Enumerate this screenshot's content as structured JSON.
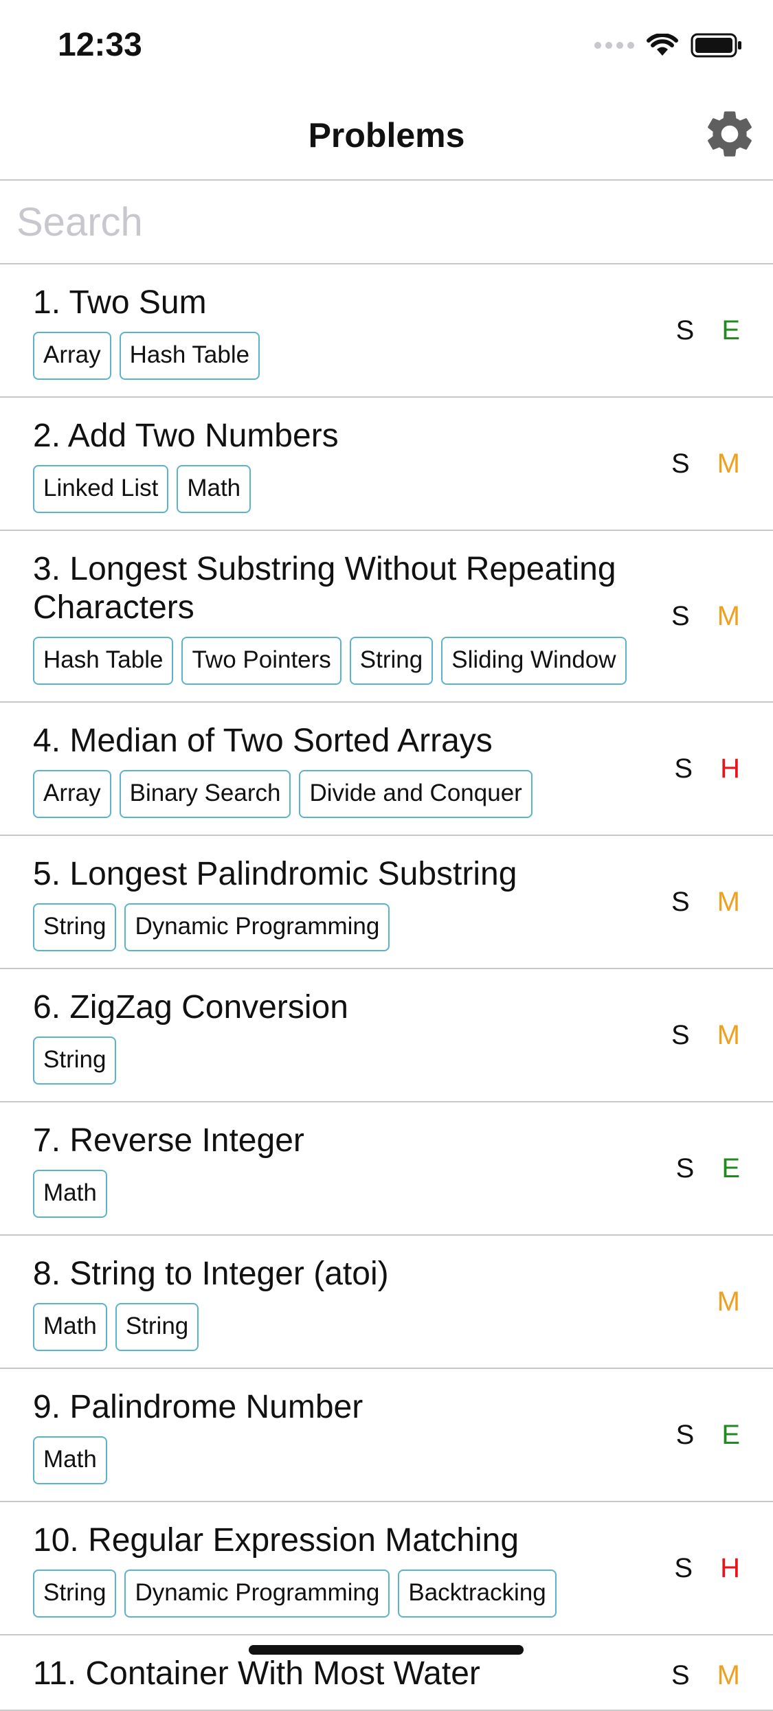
{
  "status_bar": {
    "time": "12:33"
  },
  "nav": {
    "title": "Problems",
    "settings_icon": "gear-icon"
  },
  "search": {
    "placeholder": "Search",
    "value": ""
  },
  "colors": {
    "tag_border": "#5ab3c8",
    "easy": "#1f8a1f",
    "medium": "#f0a020",
    "hard": "#e8141a"
  },
  "problems": [
    {
      "title": "1. Two Sum",
      "solved": "S",
      "difficulty": "E",
      "tags": [
        "Array",
        "Hash Table"
      ]
    },
    {
      "title": "2. Add Two Numbers",
      "solved": "S",
      "difficulty": "M",
      "tags": [
        "Linked List",
        "Math"
      ]
    },
    {
      "title": "3. Longest Substring Without Repeating Characters",
      "solved": "S",
      "difficulty": "M",
      "tags": [
        "Hash Table",
        "Two Pointers",
        "String",
        "Sliding Window"
      ]
    },
    {
      "title": "4. Median of Two Sorted Arrays",
      "solved": "S",
      "difficulty": "H",
      "tags": [
        "Array",
        "Binary Search",
        "Divide and Conquer"
      ]
    },
    {
      "title": "5. Longest Palindromic Substring",
      "solved": "S",
      "difficulty": "M",
      "tags": [
        "String",
        "Dynamic Programming"
      ]
    },
    {
      "title": "6. ZigZag Conversion",
      "solved": "S",
      "difficulty": "M",
      "tags": [
        "String"
      ]
    },
    {
      "title": "7. Reverse Integer",
      "solved": "S",
      "difficulty": "E",
      "tags": [
        "Math"
      ]
    },
    {
      "title": "8. String to Integer (atoi)",
      "solved": "",
      "difficulty": "M",
      "tags": [
        "Math",
        "String"
      ]
    },
    {
      "title": "9. Palindrome Number",
      "solved": "S",
      "difficulty": "E",
      "tags": [
        "Math"
      ]
    },
    {
      "title": "10. Regular Expression Matching",
      "solved": "S",
      "difficulty": "H",
      "tags": [
        "String",
        "Dynamic Programming",
        "Backtracking"
      ]
    },
    {
      "title": "11. Container With Most Water",
      "solved": "S",
      "difficulty": "M",
      "tags": []
    }
  ]
}
